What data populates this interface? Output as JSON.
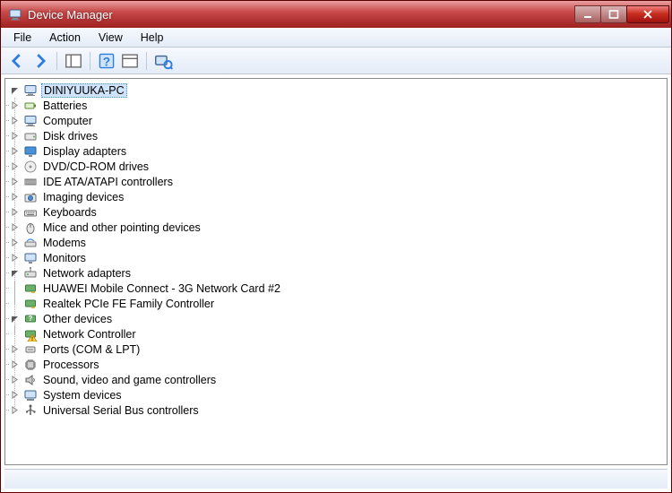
{
  "window": {
    "title": "Device Manager"
  },
  "menu": {
    "file": "File",
    "action": "Action",
    "view": "View",
    "help": "Help"
  },
  "tree": {
    "root": {
      "label": "DINIYUUKA-PC",
      "expanded": true,
      "selected": true,
      "icon": "computer",
      "children": [
        {
          "label": "Batteries",
          "icon": "battery",
          "expanded": false,
          "hasChildren": true
        },
        {
          "label": "Computer",
          "icon": "computer",
          "expanded": false,
          "hasChildren": true
        },
        {
          "label": "Disk drives",
          "icon": "disk",
          "expanded": false,
          "hasChildren": true
        },
        {
          "label": "Display adapters",
          "icon": "display",
          "expanded": false,
          "hasChildren": true
        },
        {
          "label": "DVD/CD-ROM drives",
          "icon": "disc",
          "expanded": false,
          "hasChildren": true
        },
        {
          "label": "IDE ATA/ATAPI controllers",
          "icon": "ide",
          "expanded": false,
          "hasChildren": true
        },
        {
          "label": "Imaging devices",
          "icon": "imaging",
          "expanded": false,
          "hasChildren": true
        },
        {
          "label": "Keyboards",
          "icon": "keyboard",
          "expanded": false,
          "hasChildren": true
        },
        {
          "label": "Mice and other pointing devices",
          "icon": "mouse",
          "expanded": false,
          "hasChildren": true
        },
        {
          "label": "Modems",
          "icon": "modem",
          "expanded": false,
          "hasChildren": true
        },
        {
          "label": "Monitors",
          "icon": "monitor",
          "expanded": false,
          "hasChildren": true
        },
        {
          "label": "Network adapters",
          "icon": "network",
          "expanded": true,
          "hasChildren": true,
          "children": [
            {
              "label": "HUAWEI Mobile Connect - 3G Network Card #2",
              "icon": "nic",
              "hasChildren": false
            },
            {
              "label": "Realtek PCIe FE Family Controller",
              "icon": "nic",
              "hasChildren": false
            }
          ]
        },
        {
          "label": "Other devices",
          "icon": "other",
          "expanded": true,
          "hasChildren": true,
          "children": [
            {
              "label": "Network Controller",
              "icon": "warning",
              "hasChildren": false
            }
          ]
        },
        {
          "label": "Ports (COM & LPT)",
          "icon": "port",
          "expanded": false,
          "hasChildren": true
        },
        {
          "label": "Processors",
          "icon": "cpu",
          "expanded": false,
          "hasChildren": true
        },
        {
          "label": "Sound, video and game controllers",
          "icon": "sound",
          "expanded": false,
          "hasChildren": true
        },
        {
          "label": "System devices",
          "icon": "system",
          "expanded": false,
          "hasChildren": true
        },
        {
          "label": "Universal Serial Bus controllers",
          "icon": "usb",
          "expanded": false,
          "hasChildren": true
        }
      ]
    }
  }
}
